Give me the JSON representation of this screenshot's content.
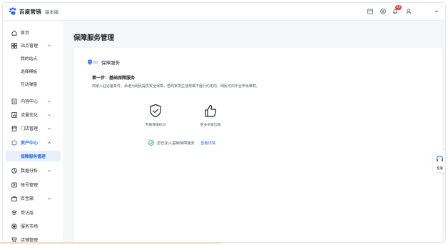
{
  "header": {
    "brand": "百度营销",
    "edition": "基本版",
    "notification_count": "35",
    "icons": [
      "calendar-icon",
      "settings-icon",
      "bell-icon",
      "user-icon",
      "chevron-down-icon"
    ]
  },
  "sidebar": {
    "items": [
      {
        "label": "首页",
        "icon": "home-icon"
      },
      {
        "label": "站点管理",
        "icon": "grid-icon",
        "expanded": true
      },
      {
        "label": "我的站点",
        "sub": true
      },
      {
        "label": "选择模板",
        "sub": true
      },
      {
        "label": "互动弹窗",
        "sub": true
      },
      {
        "label": "内容中心",
        "icon": "document-icon"
      },
      {
        "label": "流量优化",
        "icon": "chart-icon"
      },
      {
        "label": "门店管理",
        "icon": "store-icon"
      },
      {
        "label": "资产中心",
        "icon": "asset-icon",
        "expanded": true,
        "active": true
      },
      {
        "label": "保障服务管理",
        "sub": true,
        "active": true
      },
      {
        "label": "数据分析",
        "icon": "analytics-icon"
      },
      {
        "label": "账号管理",
        "icon": "account-icon"
      },
      {
        "label": "百宝箱",
        "icon": "toolbox-icon"
      },
      {
        "label": "受访层",
        "icon": "layer-icon"
      },
      {
        "label": "服务市场",
        "icon": "market-icon"
      },
      {
        "label": "店铺管理",
        "icon": "shop-icon"
      }
    ]
  },
  "main": {
    "page_title": "保障服务管理",
    "card_title": "保障服务",
    "step_title": "第一步：基础保障服务",
    "step_desc": "商家入驻必备条件，承诺为网民提供安全保障，若商家发生违规或不履行约定的，网民可向平台申诉维权。",
    "features": [
      {
        "label": "专属保障标识",
        "icon": "shield-check-icon"
      },
      {
        "label": "更多买家信赖",
        "icon": "thumbs-up-icon"
      }
    ],
    "status_text": "您已加入基础保障服务",
    "status_link": "查看详情"
  },
  "float": {
    "label": "客服"
  },
  "colors": {
    "accent": "#2468f2",
    "success": "#00b42a",
    "badge": "#f53f3f"
  }
}
